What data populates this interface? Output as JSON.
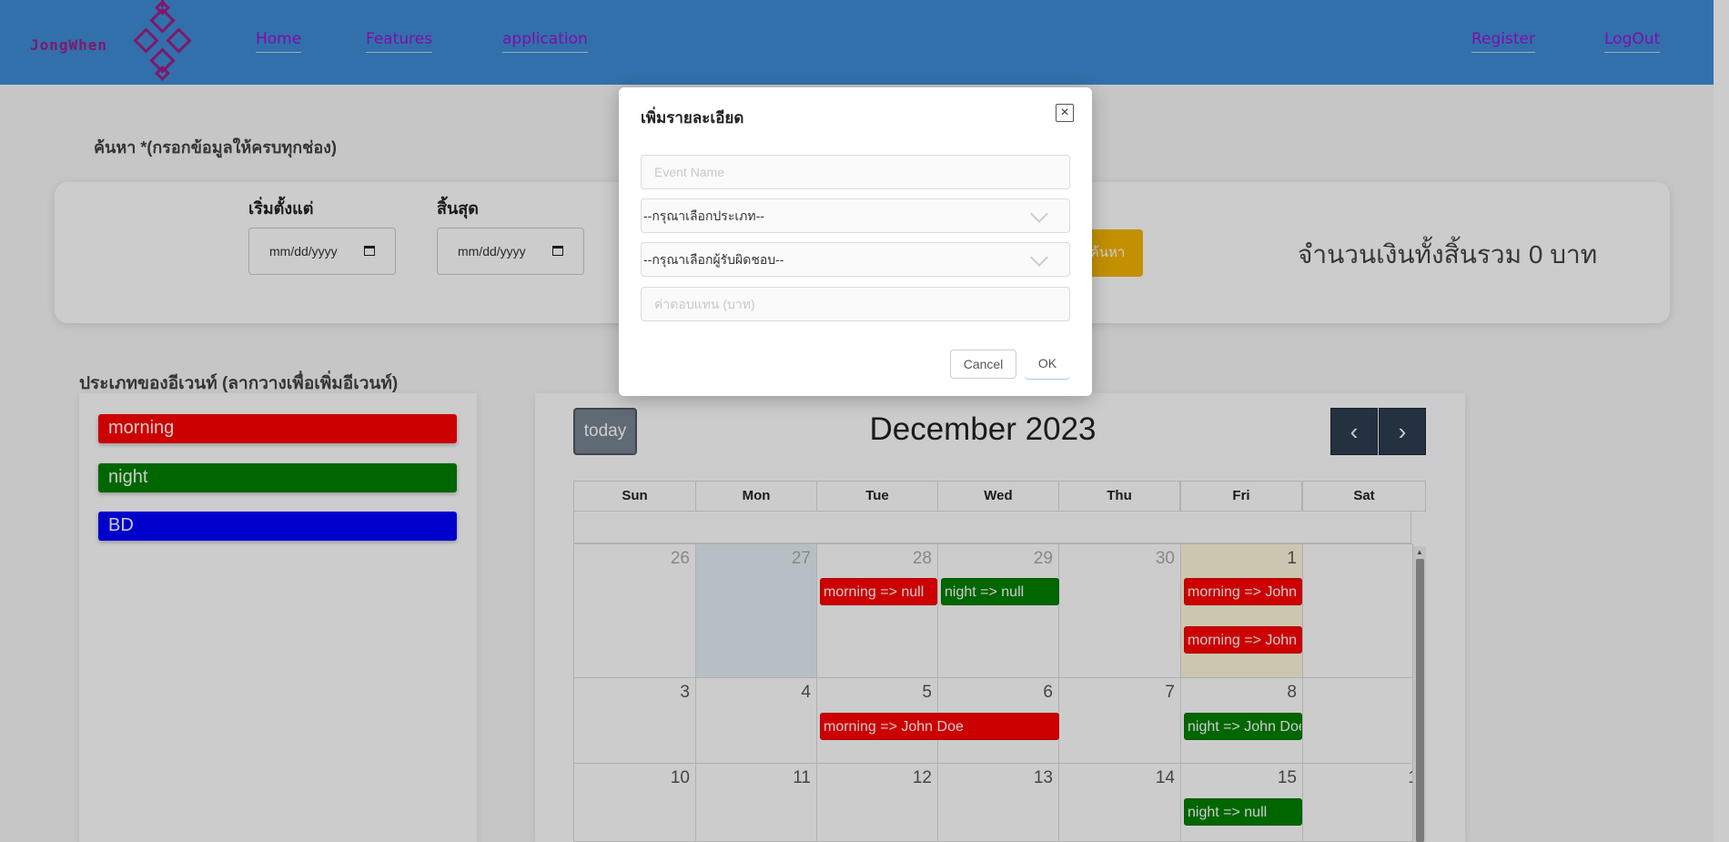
{
  "navbar": {
    "brand": "JongWhen",
    "links": [
      "Home",
      "Features",
      "application"
    ],
    "right_links": [
      "Register",
      "LogOut"
    ]
  },
  "search": {
    "title": "ค้นหา *(กรอกข้อมูลให้ครบทุกช่อง)",
    "start_label": "เริ่มตั้งแต่",
    "end_label": "สิ้นสุด",
    "start_placeholder": "mm/dd/yyyy",
    "end_placeholder": "mm/dd/yyyy",
    "search_button": "ค้นหา",
    "total_text": "จำนวนเงินทั้งสิ้นรวม 0 บาท"
  },
  "event_types": {
    "title": "ประเภทของอีเวนท์ (ลากวางเพื่อเพิ่มอีเวนท์)",
    "items": [
      {
        "label": "morning",
        "color": "#ff0000"
      },
      {
        "label": "night",
        "color": "#008000"
      },
      {
        "label": "BD",
        "color": "#0000ff"
      }
    ]
  },
  "calendar": {
    "today_button": "today",
    "title": "December 2023",
    "prev_icon": "chevron-left-icon",
    "next_icon": "chevron-right-icon",
    "days_of_week": [
      "Sun",
      "Mon",
      "Tue",
      "Wed",
      "Thu",
      "Fri",
      "Sat"
    ],
    "weeks": [
      [
        "26",
        "27",
        "28",
        "29",
        "30",
        "1",
        ""
      ],
      [
        "3",
        "4",
        "5",
        "6",
        "7",
        "8",
        ""
      ],
      [
        "10",
        "11",
        "12",
        "13",
        "14",
        "15",
        "1"
      ]
    ],
    "events": [
      {
        "label": "morning => null",
        "color": "red"
      },
      {
        "label": "night => null",
        "color": "green"
      },
      {
        "label": "morning => John D",
        "color": "red"
      },
      {
        "label": "morning => John D",
        "color": "red"
      },
      {
        "label": "morning => John Doe",
        "color": "red"
      },
      {
        "label": "night => John Doe",
        "color": "green"
      },
      {
        "label": "night => null",
        "color": "green"
      }
    ]
  },
  "modal": {
    "title": "เพิ่มรายละเอียด",
    "event_name_placeholder": "Event Name",
    "type_select": "--กรุณาเลือกประเภท--",
    "owner_select": "--กรุณาเลือกผู้รับผิดชอบ--",
    "fee_placeholder": "ค่าตอบแทน (บาท)",
    "cancel_button": "Cancel",
    "ok_button": "OK",
    "close_icon": "close-icon"
  }
}
